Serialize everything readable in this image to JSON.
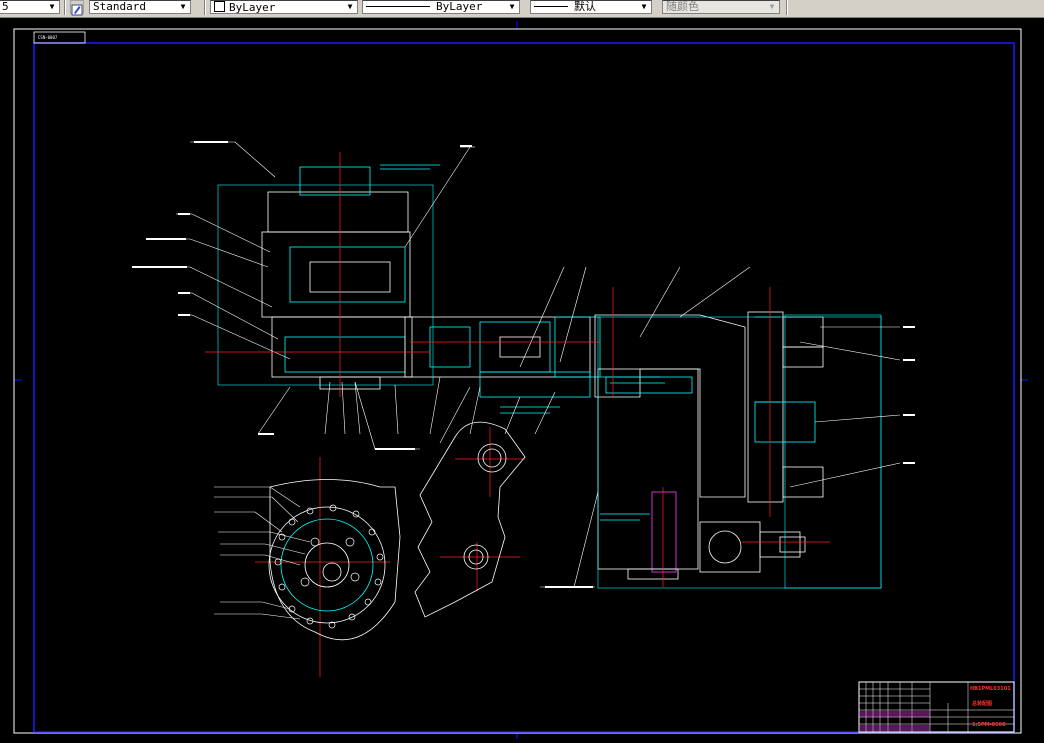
{
  "toolbar": {
    "left_value": "5",
    "text_style": "Standard",
    "layer_color": "ByLayer",
    "linetype": "ByLayer",
    "lineweight": "默认",
    "plot_style": "随颜色"
  },
  "drawing": {
    "tab_label": "CSN-0007",
    "title_block": {
      "drawing_number": "HB1PML03101",
      "drawing_name": "总装配图",
      "scale_code": "1:5PM-0500"
    }
  },
  "colors": {
    "background": "#000000",
    "toolbar": "#d4d0c8",
    "frame": "#1010ff",
    "geometry": "#ffffff",
    "dimension": "#00ffff",
    "centerline": "#ff2020",
    "hatch": "#ff40ff"
  }
}
